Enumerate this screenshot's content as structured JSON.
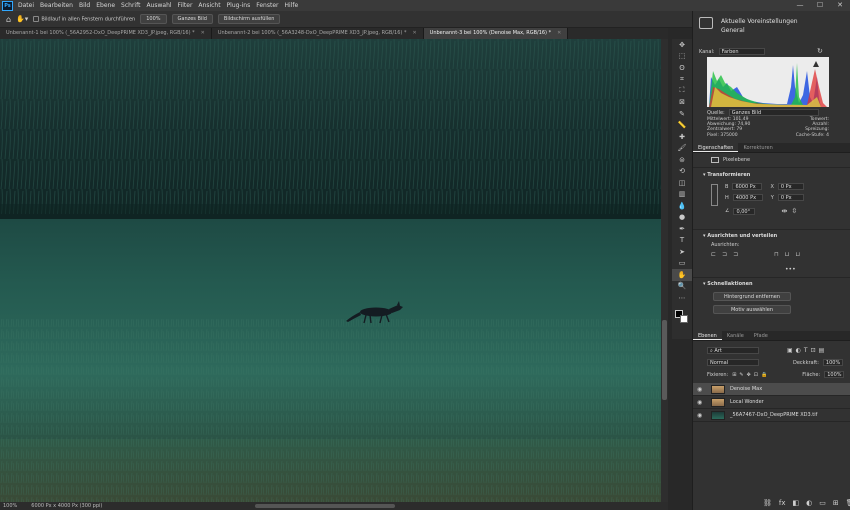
{
  "app": {
    "logo": "Ps"
  },
  "menubar": {
    "items": [
      "Datei",
      "Bearbeiten",
      "Bild",
      "Ebene",
      "Schrift",
      "Auswahl",
      "Filter",
      "Ansicht",
      "Plug-ins",
      "Fenster",
      "Hilfe"
    ]
  },
  "window_controls": {
    "minimize": "—",
    "maximize": "☐",
    "close": "✕"
  },
  "options_bar": {
    "scroll_all_label": "Bildlauf in allen Fenstern durchführen",
    "btn_100": "100%",
    "btn_fit": "Ganzes Bild",
    "btn_fill": "Bildschirm ausfüllen"
  },
  "tabs": [
    {
      "label": "Unbenannt-1 bei 100% (_56A2952-DxO_DeepPRIME XD3_JP.jpeg, RGB/16) *",
      "active": false
    },
    {
      "label": "Unbenannt-2 bei 100% (_56A3248-DxO_DeepPRIME XD3_JP.jpeg, RGB/16) *",
      "active": false
    },
    {
      "label": "Unbenannt-3 bei 100% (Denoise Max, RGB/16) *",
      "active": true
    }
  ],
  "status": {
    "zoom": "100%",
    "docsize": "6000 Px x 4000 Px (300 ppi)"
  },
  "tools": [
    "move-icon",
    "marquee-icon",
    "lasso-icon",
    "object-select-icon",
    "crop-icon",
    "frame-icon",
    "eyedropper-icon",
    "ruler-icon",
    "spot-heal-icon",
    "brush-icon",
    "stamp-icon",
    "history-brush-icon",
    "eraser-icon",
    "gradient-icon",
    "blur-icon",
    "dodge-icon",
    "pen-icon",
    "type-icon",
    "path-select-icon",
    "rectangle-icon",
    "hand-icon",
    "zoom-icon",
    "more-icon"
  ],
  "tool_glyphs": [
    "✥",
    "⬚",
    "ʘ",
    "⌗",
    "⛶",
    "⊠",
    "✎",
    "📏",
    "✚",
    "🖌",
    "⊜",
    "⟲",
    "◫",
    "▥",
    "💧",
    "●",
    "✒",
    "T",
    "➤",
    "▭",
    "✋",
    "🔍",
    "⋯"
  ],
  "histogram": {
    "header_title": "Aktuelle Voreinstellungen",
    "header_sub": "General",
    "channel_label": "Kanal:",
    "channel_value": "Farben",
    "source_label": "Quelle:",
    "source_value": "Ganzes Bild",
    "stats_left": [
      {
        "k": "Mittelwert:",
        "v": "101,49"
      },
      {
        "k": "Abweichung:",
        "v": "74,90"
      },
      {
        "k": "Zentralwert:",
        "v": "79"
      },
      {
        "k": "Pixel:",
        "v": "375000"
      }
    ],
    "stats_right": [
      {
        "k": "Tonwert:",
        "v": ""
      },
      {
        "k": "Anzahl:",
        "v": ""
      },
      {
        "k": "Spreizung:",
        "v": ""
      },
      {
        "k": "Cache-Stufe:",
        "v": "4"
      }
    ]
  },
  "properties": {
    "tabs": [
      "Eigenschaften",
      "Korrekturen"
    ],
    "layer_type": "Pixelebene",
    "transform_title": "Transformieren",
    "w_label": "B",
    "w_value": "6000 Px",
    "h_label": "H",
    "h_value": "4000 Px",
    "x_label": "X",
    "x_value": "0 Px",
    "y_label": "Y",
    "y_value": "0 Px",
    "angle_value": "0,00°",
    "align_title": "Ausrichten und verteilen",
    "align_label": "Ausrichten:",
    "quick_title": "Schnellaktionen",
    "btn_remove_bg": "Hintergrund entfernen",
    "btn_select_subject": "Motiv auswählen"
  },
  "layers": {
    "tabs": [
      "Ebenen",
      "Kanäle",
      "Pfade"
    ],
    "filter_label": "Art",
    "blend_mode": "Normal",
    "opacity_label": "Deckkraft:",
    "opacity_value": "100%",
    "lock_label": "Fixieren:",
    "fill_label": "Fläche:",
    "fill_value": "100%",
    "items": [
      {
        "name": "Denoise Max",
        "selected": true
      },
      {
        "name": "Local Wonder",
        "selected": false
      },
      {
        "name": "_56A7467-DxO_DeepPRIME XD3.tif",
        "selected": false
      }
    ]
  },
  "colors": {
    "accent": "#31a8ff",
    "panel": "#323232",
    "canvas_top": "#1b3a36",
    "canvas_field": "#25594f"
  }
}
